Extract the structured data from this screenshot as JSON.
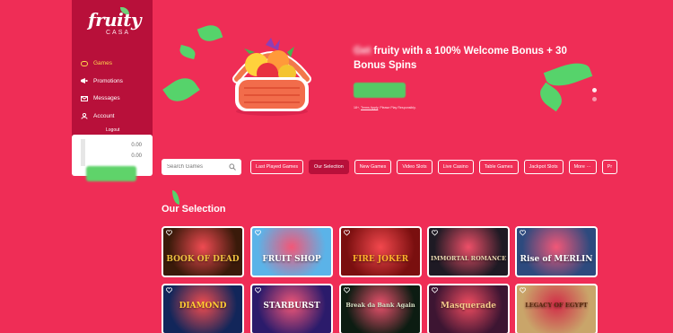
{
  "brand": {
    "name": "fruity",
    "sub": "CASA"
  },
  "sidebar": {
    "items": [
      {
        "label": "Games",
        "icon": "gamepad-icon"
      },
      {
        "label": "Promotions",
        "icon": "megaphone-icon"
      },
      {
        "label": "Messages",
        "icon": "envelope-icon"
      },
      {
        "label": "Account",
        "icon": "user-icon"
      }
    ],
    "logout": "Logout",
    "balance": {
      "value1": "0.00",
      "value2": "0.00"
    }
  },
  "hero": {
    "title_blur": "Get",
    "title_rest": " fruity with a 100% Welcome Bonus + 30 Bonus Spins",
    "terms_prefix": "18+, ",
    "terms_link": "Terms Apply",
    "terms_suffix": ". Please Play Responsibly."
  },
  "search": {
    "placeholder": "Search Games"
  },
  "filters": [
    "Last Played Games",
    "Our Selection",
    "New Games",
    "Video Slots",
    "Live Casino",
    "Table Games",
    "Jackpot Slots",
    "More ···",
    "Pr"
  ],
  "section": {
    "title": "Our Selection"
  },
  "games": [
    {
      "name": "BOOK OF DEAD",
      "bg": "#3a1a0a",
      "fg": "#f0c040"
    },
    {
      "name": "FRUIT SHOP",
      "bg": "#5bb3e8",
      "fg": "#ffffff"
    },
    {
      "name": "FIRE JOKER",
      "bg": "#7a0f0f",
      "fg": "#ffb22a"
    },
    {
      "name": "IMMORTAL ROMANCE",
      "bg": "#1e1a24",
      "fg": "#e9d7b0"
    },
    {
      "name": "Rise of MERLIN",
      "bg": "#2d4a7e",
      "fg": "#ffffff"
    },
    {
      "name": "DIAMOND",
      "bg": "#12265a",
      "fg": "#ffcc33"
    },
    {
      "name": "STARBURST",
      "bg": "#2b1b6b",
      "fg": "#ffffff"
    },
    {
      "name": "Break da Bank Again",
      "bg": "#0c1c12",
      "fg": "#d9e5c8"
    },
    {
      "name": "Masquerade",
      "bg": "#3d1532",
      "fg": "#f3c88a"
    },
    {
      "name": "LEGACY OF EGYPT",
      "bg": "#c9a56a",
      "fg": "#5a2a0e"
    }
  ]
}
